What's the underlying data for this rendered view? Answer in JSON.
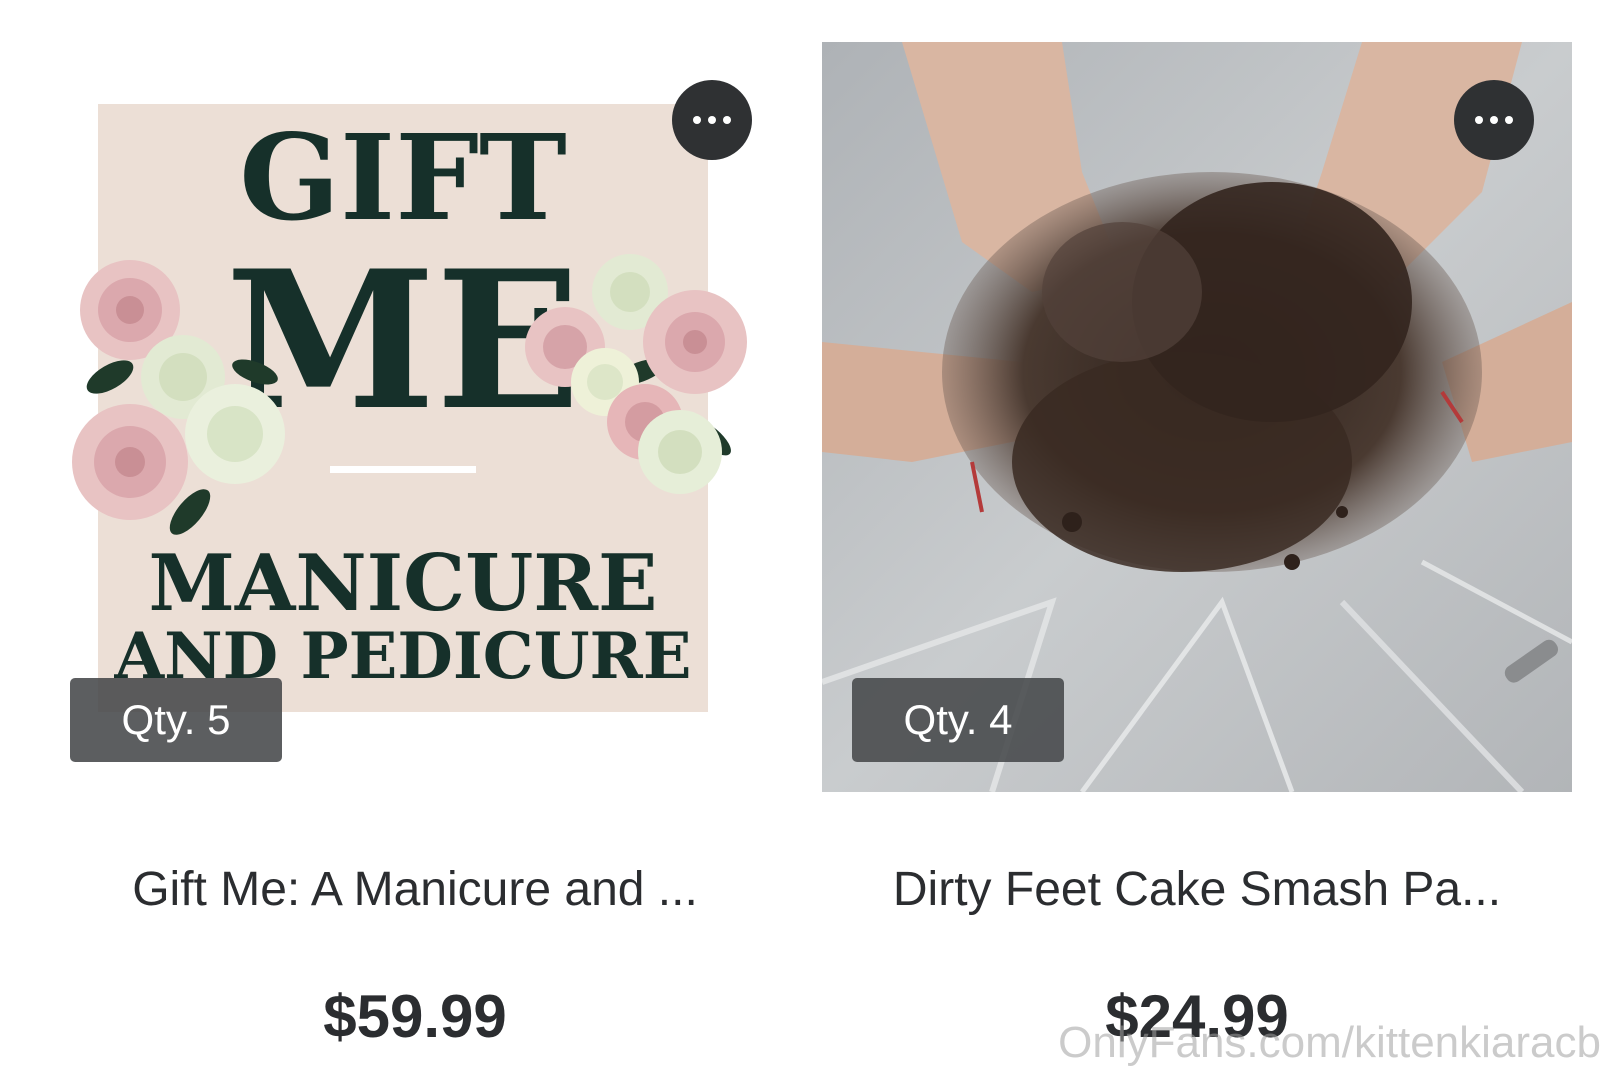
{
  "products": [
    {
      "name": "Gift Me: A Manicure and ...",
      "price": "$59.99",
      "quantity": "Qty. 5",
      "image_text": {
        "line1": "GIFT",
        "line2": "ME",
        "line3": "MANICURE",
        "line4": "AND PEDICURE"
      },
      "image_colors": {
        "background": "#ecdfd6",
        "text": "#16302a",
        "rose_pink": "#e8b9b9",
        "rose_cream": "#eef1d8"
      }
    },
    {
      "name": "Dirty Feet Cake Smash Pa...",
      "price": "$24.99",
      "quantity": "Qty. 4",
      "image_colors": {
        "plastic": "#b9bcbf",
        "cake": "#3a2a22",
        "skin": "#d9b6a2"
      }
    }
  ],
  "more_icon": "more-horizontal-icon",
  "watermark": "OnlyFans.com/kittenkiaracb"
}
